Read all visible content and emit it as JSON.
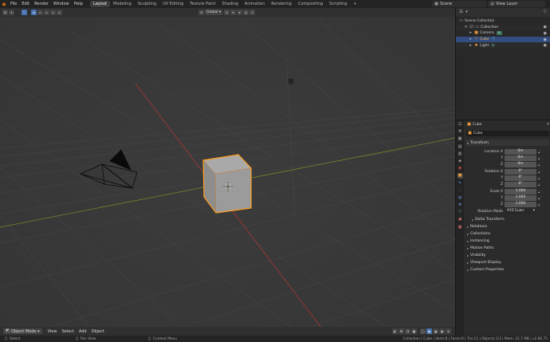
{
  "topbar": {
    "menus": [
      "File",
      "Edit",
      "Render",
      "Window",
      "Help"
    ],
    "tabs": [
      "Layout",
      "Modeling",
      "Sculpting",
      "UV Editing",
      "Texture Paint",
      "Shading",
      "Animation",
      "Rendering",
      "Compositing",
      "Scripting"
    ],
    "active_tab": "Layout",
    "scene": "Scene",
    "view_layer": "View Layer"
  },
  "viewport": {
    "orientation_label": "Global",
    "object_mode": "Object Mode",
    "menus": [
      "View",
      "Select",
      "Add",
      "Object"
    ]
  },
  "outliner": {
    "rows": [
      {
        "label": "Scene Collection",
        "indent": 0
      },
      {
        "label": "Collection",
        "indent": 1
      },
      {
        "label": "Camera",
        "indent": 2
      },
      {
        "label": "Cube",
        "indent": 2
      },
      {
        "label": "Light",
        "indent": 2
      }
    ]
  },
  "properties": {
    "object_name": "Cube",
    "name_field": "Cube",
    "transform_title": "Transform",
    "location_label": "Location X",
    "rotation_label": "Rotation X",
    "scale_label": "Scale X",
    "axis_y": "Y",
    "axis_z": "Z",
    "location": [
      "0m",
      "0m",
      "0m"
    ],
    "rotation": [
      "0°",
      "0°",
      "0°"
    ],
    "scale": [
      "1.000",
      "1.000",
      "1.000"
    ],
    "rotation_mode_label": "Rotation Mode",
    "rotation_mode": "XYZ Euler",
    "delta_transform": "Delta Transform",
    "panels": [
      "Relations",
      "Collections",
      "Instancing",
      "Motion Paths",
      "Visibility",
      "Viewport Display",
      "Custom Properties"
    ]
  },
  "statusbar": {
    "select": "Select",
    "pan_view": "Pan View",
    "context_menu": "Context Menu",
    "stats": "Collection | Cube | Verts:8 | Faces:6 | Tris:12 | Objects:1/3 | Mem: 22.7 MB | v2.80.75"
  },
  "colors": {
    "accent_blue": "#4772b3",
    "selection_orange": "#ffa020",
    "x_axis": "#b03a3a",
    "y_axis": "#7c9a2a"
  }
}
